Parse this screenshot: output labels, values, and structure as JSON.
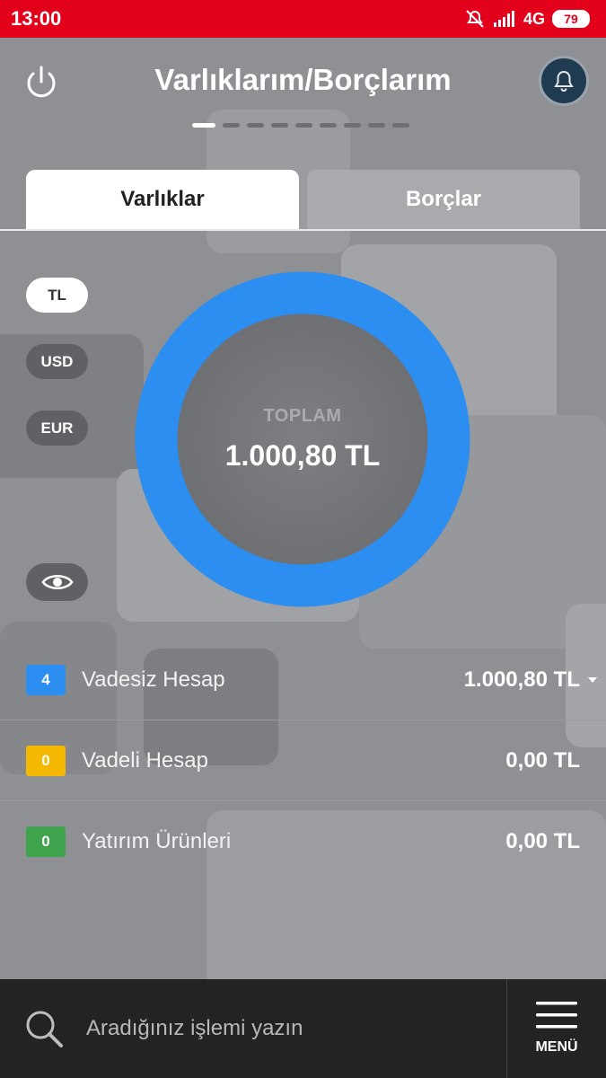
{
  "status_bar": {
    "time": "13:00",
    "network": "4G",
    "battery": "79"
  },
  "header": {
    "title": "Varlıklarım/Borçlarım",
    "page_count": 9,
    "active_page": 1
  },
  "tabs": [
    {
      "label": "Varlıklar",
      "active": true
    },
    {
      "label": "Borçlar",
      "active": false
    }
  ],
  "currencies": [
    {
      "label": "TL",
      "active": true
    },
    {
      "label": "USD",
      "active": false
    },
    {
      "label": "EUR",
      "active": false
    }
  ],
  "summary": {
    "label": "TOPLAM",
    "value": "1.000,80 TL",
    "ring_color": "#2b8ef0"
  },
  "accounts": [
    {
      "count": "4",
      "label": "Vadesiz Hesap",
      "value": "1.000,80 TL",
      "color": "#2b8ef0",
      "expandable": true
    },
    {
      "count": "0",
      "label": "Vadeli Hesap",
      "value": "0,00 TL",
      "color": "#f5b800",
      "expandable": false
    },
    {
      "count": "0",
      "label": "Yatırım Ürünleri",
      "value": "0,00 TL",
      "color": "#3fa34d",
      "expandable": false
    }
  ],
  "bottom_bar": {
    "search_placeholder": "Aradığınız işlemi yazın",
    "menu_label": "MENÜ"
  }
}
